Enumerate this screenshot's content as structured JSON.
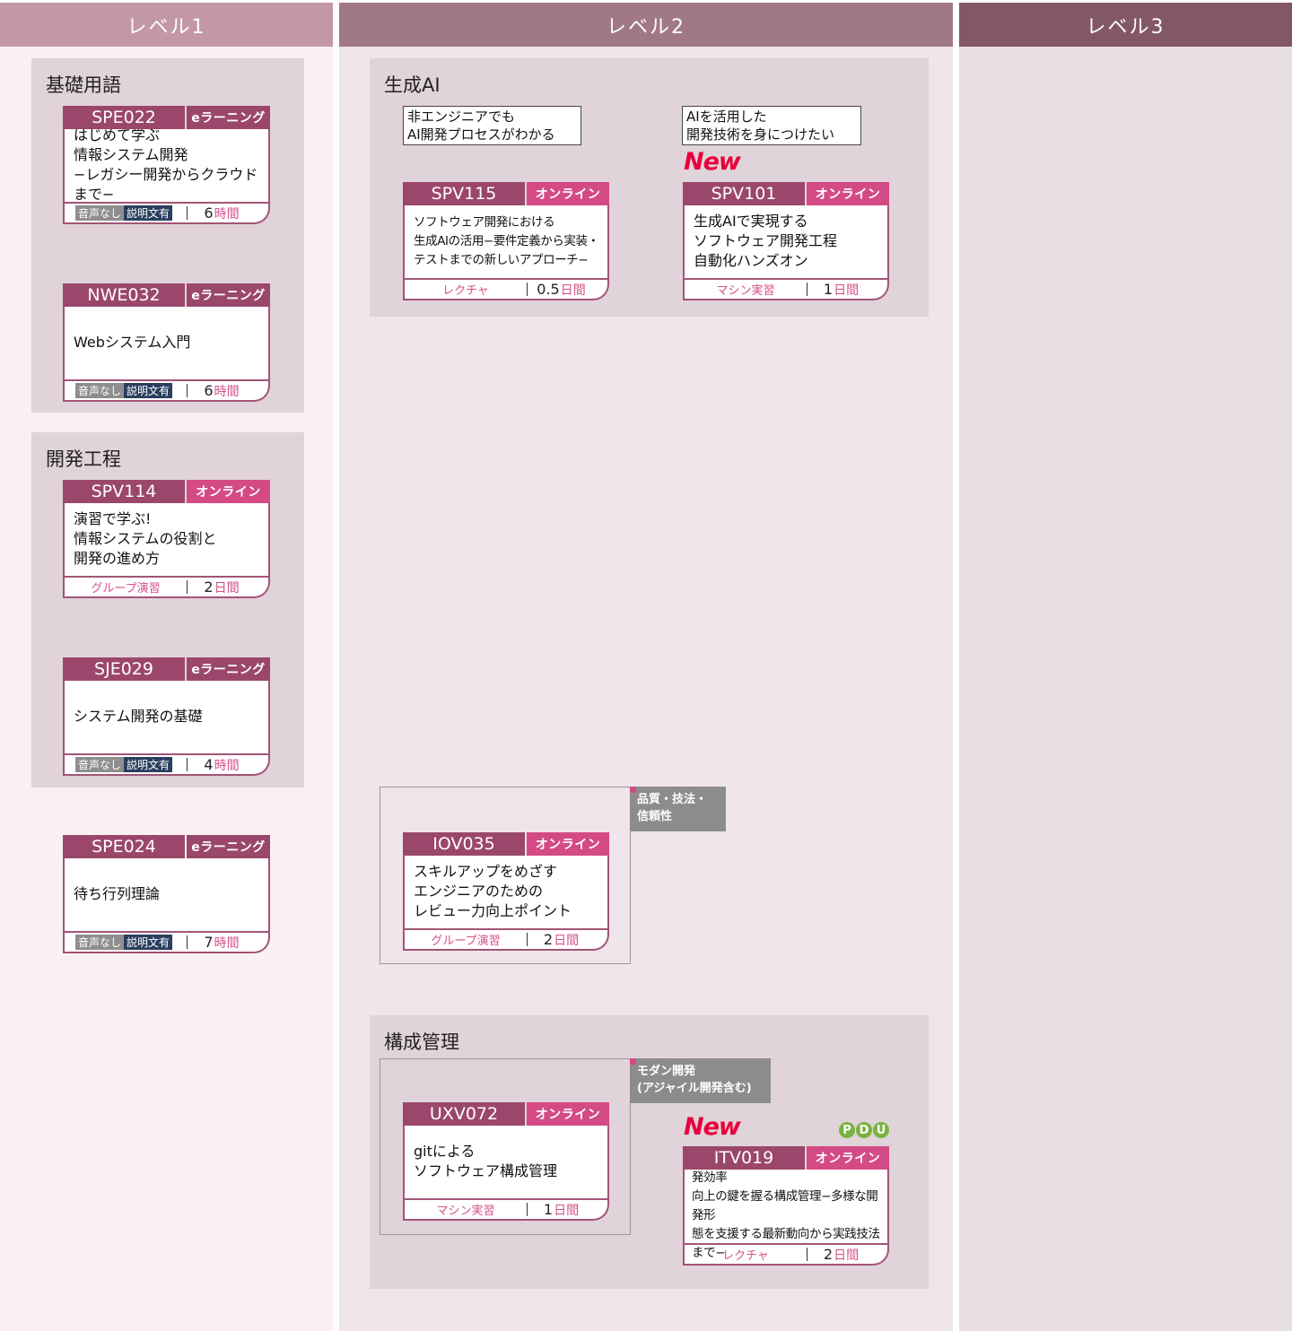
{
  "colors": {
    "level1_header": "#c497a8",
    "level2_header": "#a07888",
    "level3_header": "#835668",
    "level1_bg": "#faf0f3",
    "level2_bg": "#efe5ea",
    "level3_bg": "#e8dfe4",
    "card_code_bg": "#9b476b",
    "online_badge": "#d44a85",
    "new_mark": "#e8003c",
    "pdu_badge": "#7ab241"
  },
  "levels": [
    "レベル1",
    "レベル2",
    "レベル3"
  ],
  "level1": {
    "groups": [
      {
        "title": "基礎用語",
        "courses": [
          {
            "code": "SPE022",
            "type": "eラーニング",
            "title": "はじめて学ぶ\n情報システム開発\n−レガシー開発からクラウドまで−",
            "audio": "音声なし",
            "desc": "説明文有",
            "duration": "6",
            "unit": "時間"
          },
          {
            "code": "NWE032",
            "type": "eラーニング",
            "title": "Webシステム入門",
            "audio": "音声なし",
            "desc": "説明文有",
            "duration": "6",
            "unit": "時間"
          }
        ]
      },
      {
        "title": "開発工程",
        "courses": [
          {
            "code": "SPV114",
            "type": "オンライン",
            "title": "演習で学ぶ!\n情報システムの役割と\n開発の進め方",
            "method": "グループ演習",
            "duration": "2",
            "unit": "日間"
          },
          {
            "code": "SJE029",
            "type": "eラーニング",
            "title": "システム開発の基礎",
            "audio": "音声なし",
            "desc": "説明文有",
            "duration": "4",
            "unit": "時間"
          }
        ]
      }
    ],
    "standalone": {
      "code": "SPE024",
      "type": "eラーニング",
      "title": "待ち行列理論",
      "audio": "音声なし",
      "desc": "説明文有",
      "duration": "7",
      "unit": "時間"
    }
  },
  "level2": {
    "gen_ai": {
      "title": "生成AI",
      "target_left": "非エンジニアでも\nAI開発プロセスがわかる",
      "target_right": "AIを活用した\n開発技術を身につけたい",
      "new_label": "New",
      "course_left": {
        "code": "SPV115",
        "type": "オンライン",
        "title": "ソフトウェア開発における\n生成AIの活用−要件定義から実装・\nテストまでの新しいアプローチ−",
        "method": "レクチャ",
        "duration": "0.5",
        "unit": "日間"
      },
      "course_right": {
        "code": "SPV101",
        "type": "オンライン",
        "title": "生成AIで実現する\nソフトウェア開発工程\n自動化ハンズオン",
        "method": "マシン実習",
        "duration": "1",
        "unit": "日間"
      }
    },
    "quality": {
      "tag": "品質・技法・\n信頼性",
      "course": {
        "code": "IOV035",
        "type": "オンライン",
        "title": "スキルアップをめざす\nエンジニアのための\nレビュー力向上ポイント",
        "method": "グループ演習",
        "duration": "2",
        "unit": "日間"
      }
    },
    "config": {
      "title": "構成管理",
      "tag": "モダン開発\n(アジャイル開発含む)",
      "new_label": "New",
      "pdu_letters": [
        "P",
        "D",
        "U"
      ],
      "course_left": {
        "code": "UXV072",
        "type": "オンライン",
        "title": "gitによる\nソフトウェア構成管理",
        "method": "マシン実習",
        "duration": "1",
        "unit": "日間"
      },
      "course_right": {
        "code": "ITV019",
        "type": "オンライン",
        "title": "(PDU)ソフトウェアとシステムの開発効率\n向上の鍵を握る構成管理−多様な開発形\n態を支援する最新動向から実践技法まで−",
        "method": "レクチャ",
        "duration": "2",
        "unit": "日間"
      }
    }
  }
}
